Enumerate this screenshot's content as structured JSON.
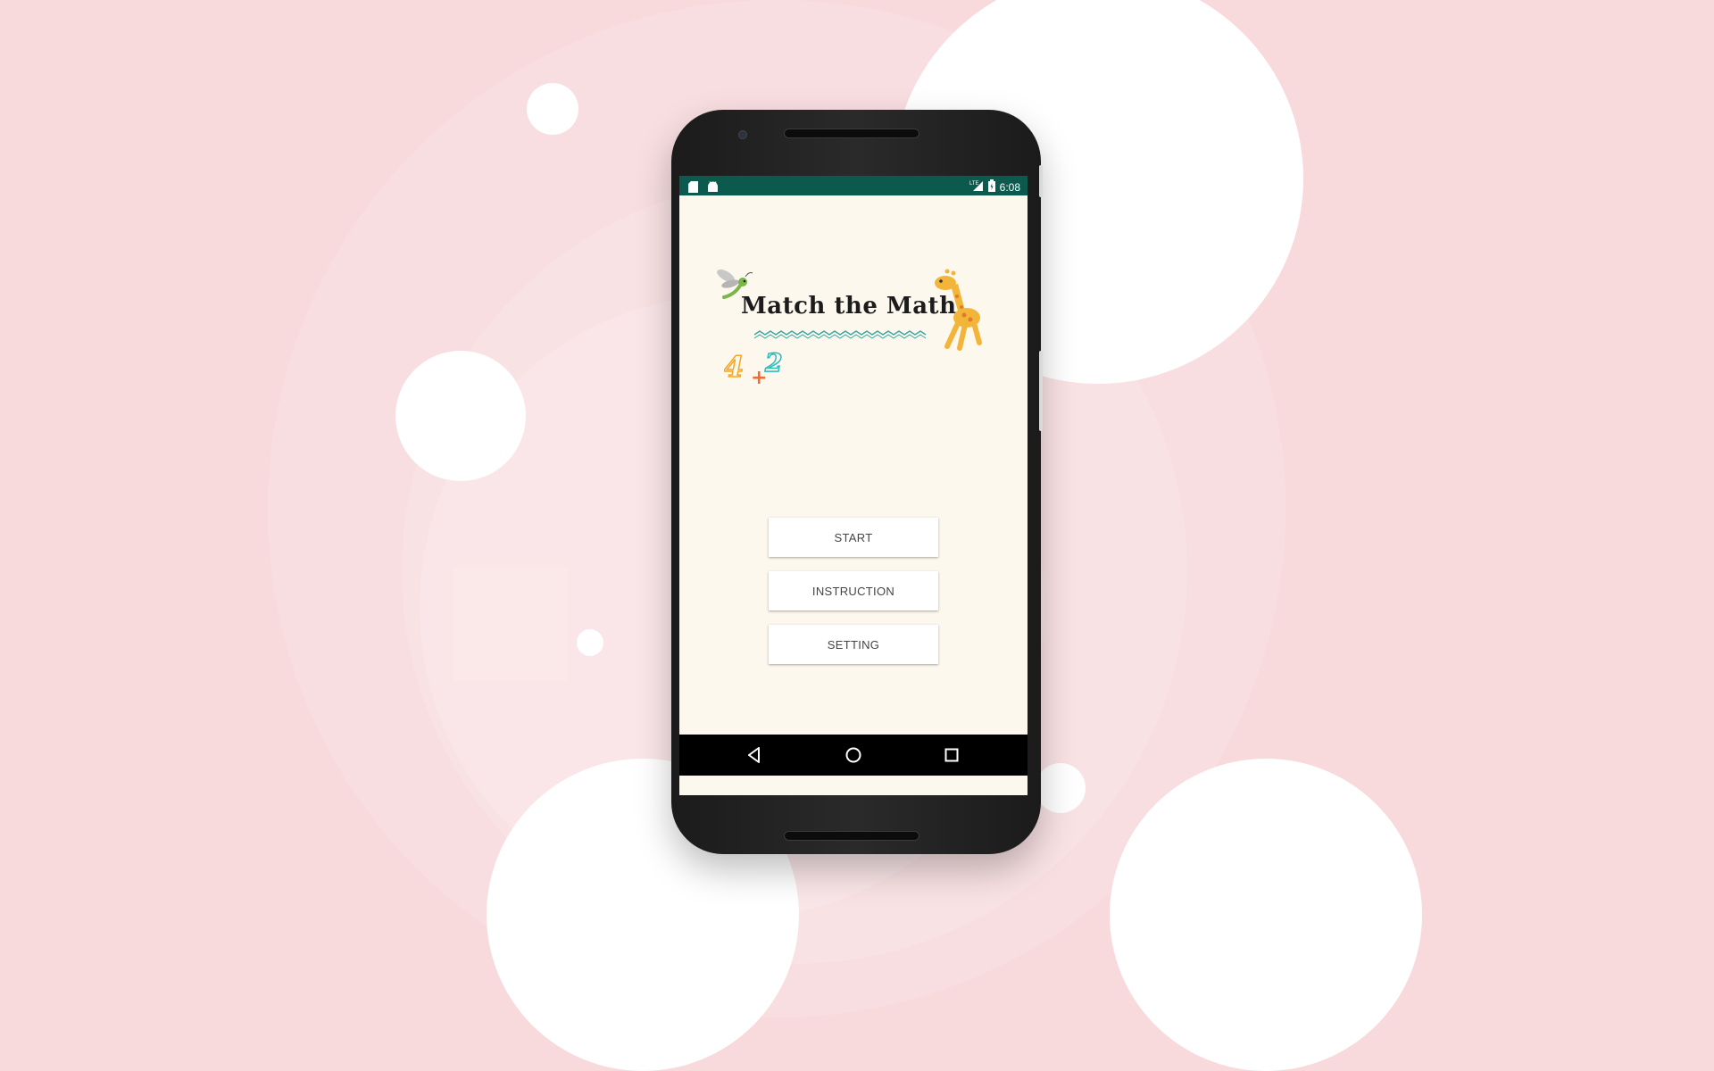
{
  "status_bar": {
    "time": "6:08",
    "left_icons": [
      "sd-card-icon",
      "android-icon"
    ],
    "right_icons": [
      "lte-signal-icon",
      "battery-icon"
    ],
    "background": "#0c5a4d"
  },
  "app": {
    "logo_title": "Match the Math",
    "logo_decoration": "4 + 2",
    "screen_background": "#fdf8ee"
  },
  "menu": {
    "start_label": "START",
    "instruction_label": "INSTRUCTION",
    "setting_label": "SETTING"
  },
  "nav_bar": {
    "icons": [
      "back-icon",
      "home-icon",
      "recents-icon"
    ]
  },
  "background": {
    "color": "#f8dadc",
    "bubble_color": "#ffffff"
  }
}
